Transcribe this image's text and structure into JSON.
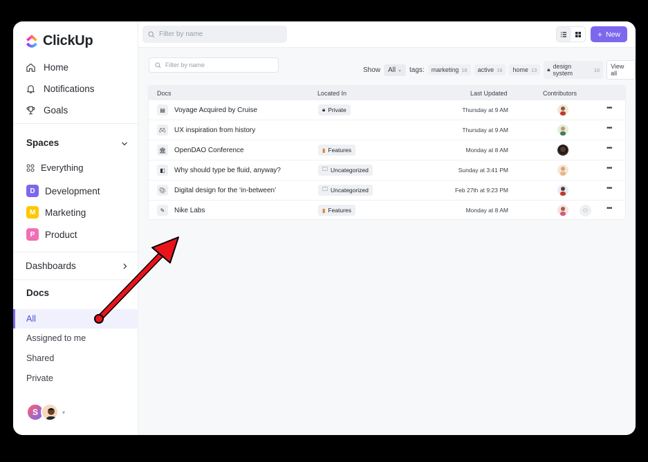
{
  "app": {
    "name": "ClickUp"
  },
  "sidebar": {
    "nav": [
      {
        "label": "Home",
        "icon": "home-icon"
      },
      {
        "label": "Notifications",
        "icon": "bell-icon"
      },
      {
        "label": "Goals",
        "icon": "trophy-icon"
      }
    ],
    "spaces_title": "Spaces",
    "everything_label": "Everything",
    "spaces": [
      {
        "letter": "D",
        "label": "Development",
        "color": "#7b68ee"
      },
      {
        "letter": "M",
        "label": "Marketing",
        "color": "#ffc800"
      },
      {
        "letter": "P",
        "label": "Product",
        "color": "#f06fb5"
      }
    ],
    "dashboards_label": "Dashboards",
    "docs_title": "Docs",
    "docs_items": [
      "All",
      "Assigned to me",
      "Shared",
      "Private"
    ],
    "avatar_letter": "S"
  },
  "topbar": {
    "search_placeholder": "Filter by name",
    "new_label": "New"
  },
  "filters": {
    "placeholder": "Filter by name",
    "show_label": "Show",
    "show_value": "All",
    "tags_label": "tags:",
    "tags": [
      {
        "name": "marketing",
        "count": "18"
      },
      {
        "name": "active",
        "count": "16"
      },
      {
        "name": "home",
        "count": "13"
      },
      {
        "name": "design system",
        "count": "10"
      }
    ],
    "view_all": "View all"
  },
  "table": {
    "headers": {
      "docs": "Docs",
      "location": "Located In",
      "updated": "Last Updated",
      "contributors": "Contributors"
    },
    "rows": [
      {
        "name": "Voyage Acquired by Cruise",
        "icon": "document-icon",
        "location": "Private",
        "location_icon": "lock-icon",
        "updated": "Thursday at 9 AM"
      },
      {
        "name": "UX inspiration from history",
        "icon": "gamepad-icon",
        "location": "",
        "location_icon": "",
        "updated": "Thursday at 9 AM"
      },
      {
        "name": "OpenDAO Conference",
        "icon": "building-icon",
        "location": "Features",
        "location_icon": "book-icon",
        "updated": "Monday at 8 AM"
      },
      {
        "name": "Why should type be fluid, anyway?",
        "icon": "page-icon",
        "location": "Uncategorized",
        "location_icon": "folder-icon",
        "updated": "Sunday at 3:41 PM"
      },
      {
        "name": "Digital design for the ‘in-between’",
        "icon": "palette-icon",
        "location": "Uncategorized",
        "location_icon": "folder-icon",
        "updated": "Feb 27th at 9:23 PM"
      },
      {
        "name": "Nike Labs",
        "icon": "tool-icon",
        "location": "Features",
        "location_icon": "book-icon",
        "updated": "Monday at 8 AM"
      }
    ]
  },
  "colors": {
    "accent": "#7b68ee",
    "annotation_arrow": "#e8141a"
  }
}
